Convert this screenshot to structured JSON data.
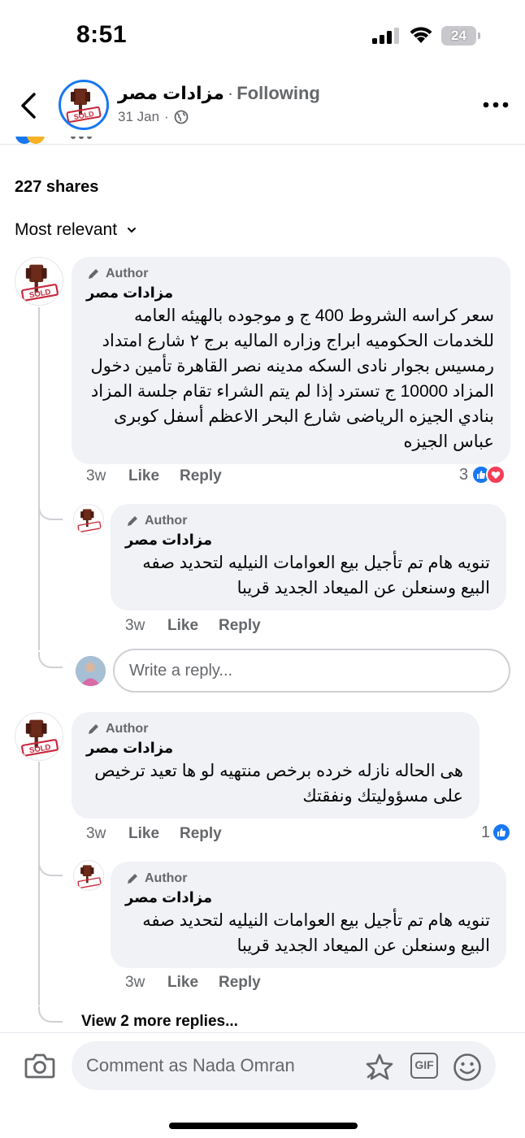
{
  "status_bar": {
    "time": "8:51",
    "battery": "24"
  },
  "header": {
    "page_name": "مزادات مصر",
    "separator": "·",
    "follow_status": "Following",
    "date": "31 Jan",
    "date_sep": "·",
    "audience_icon": "globe-icon"
  },
  "post": {
    "shares": "227 shares",
    "sort_label": "Most relevant"
  },
  "comments": [
    {
      "badge": "Author",
      "name": "مزادات مصر",
      "text": "سعر كراسه الشروط 400 ج و موجوده بالهيئه العامه للخدمات الحكوميه ابراج وزاره الماليه برج ٢ شارع امتداد رمسيس بجوار نادى السكه مدينه نصر القاهرة تأمين دخول المزاد 10000 ج تسترد إذا لم يتم الشراء تقام جلسة المزاد بنادي الجيزه الرياضى شارع البحر الاعظم أسفل كوبرى عباس الجيزه",
      "time": "3w",
      "like": "Like",
      "reply": "Reply",
      "reactions": "3"
    },
    {
      "badge": "Author",
      "name": "مزادات مصر",
      "text": "تنويه هام تم تأجيل بيع العوامات النيليه لتحديد صفه البيع وسنعلن عن الميعاد الجديد قريبا",
      "time": "3w",
      "like": "Like",
      "reply": "Reply"
    },
    {
      "badge": "Author",
      "name": "مزادات مصر",
      "text": "هى الحاله نازله خرده برخص منتهيه لو ها تعيد ترخيص على مسؤوليتك ونفقتك",
      "time": "3w",
      "like": "Like",
      "reply": "Reply",
      "reactions": "1"
    },
    {
      "badge": "Author",
      "name": "مزادات مصر",
      "text": "تنويه هام تم تأجيل بيع العوامات النيليه لتحديد صفه البيع وسنعلن عن الميعاد الجديد قريبا",
      "time": "3w",
      "like": "Like",
      "reply": "Reply"
    }
  ],
  "write_reply_placeholder": "Write a reply...",
  "view_more": "View 2 more replies...",
  "composer": {
    "placeholder": "Comment as Nada Omran",
    "icons": [
      "camera-icon",
      "sticker-icon",
      "gif-icon",
      "emoji-icon"
    ],
    "gif_label": "GIF"
  },
  "colors": {
    "accent": "#1877f2",
    "love": "#f33e58",
    "muted": "#65676b",
    "bubble": "#f0f2f5"
  }
}
